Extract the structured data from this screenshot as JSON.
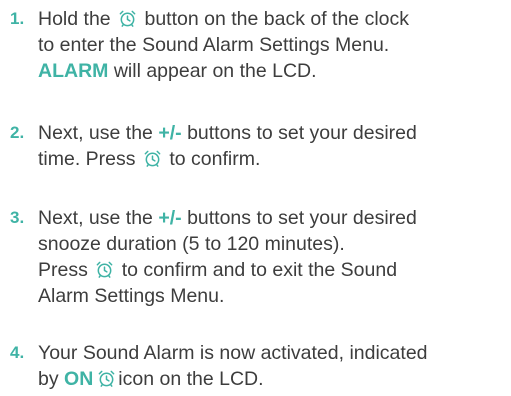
{
  "colors": {
    "accent": "#3fb3a5",
    "text": "#3d3d3d"
  },
  "icon": "alarm-clock-icon",
  "steps": [
    {
      "number": "1.",
      "l1_a": "Hold the",
      "l1_b": "button on the back of the clock",
      "l2": "to enter the Sound Alarm Settings Menu.",
      "l3_hl": "ALARM",
      "l3_b": "will appear on the LCD."
    },
    {
      "number": "2.",
      "l1_a": "Next, use the",
      "l1_hl": "+/-",
      "l1_b": "buttons to set your desired",
      "l2_a": "time. Press",
      "l2_b": "to confirm."
    },
    {
      "number": "3.",
      "l1_a": "Next, use the",
      "l1_hl": "+/-",
      "l1_b": "buttons to set your desired",
      "l2": "snooze duration (5 to 120 minutes).",
      "l3_a": "Press",
      "l3_b": "to confirm and to exit the Sound",
      "l4": "Alarm Settings Menu."
    },
    {
      "number": "4.",
      "l1": "Your Sound Alarm is now activated, indicated",
      "l2_a": "by",
      "l2_hl": "ON",
      "l2_b": "icon on the LCD."
    }
  ]
}
